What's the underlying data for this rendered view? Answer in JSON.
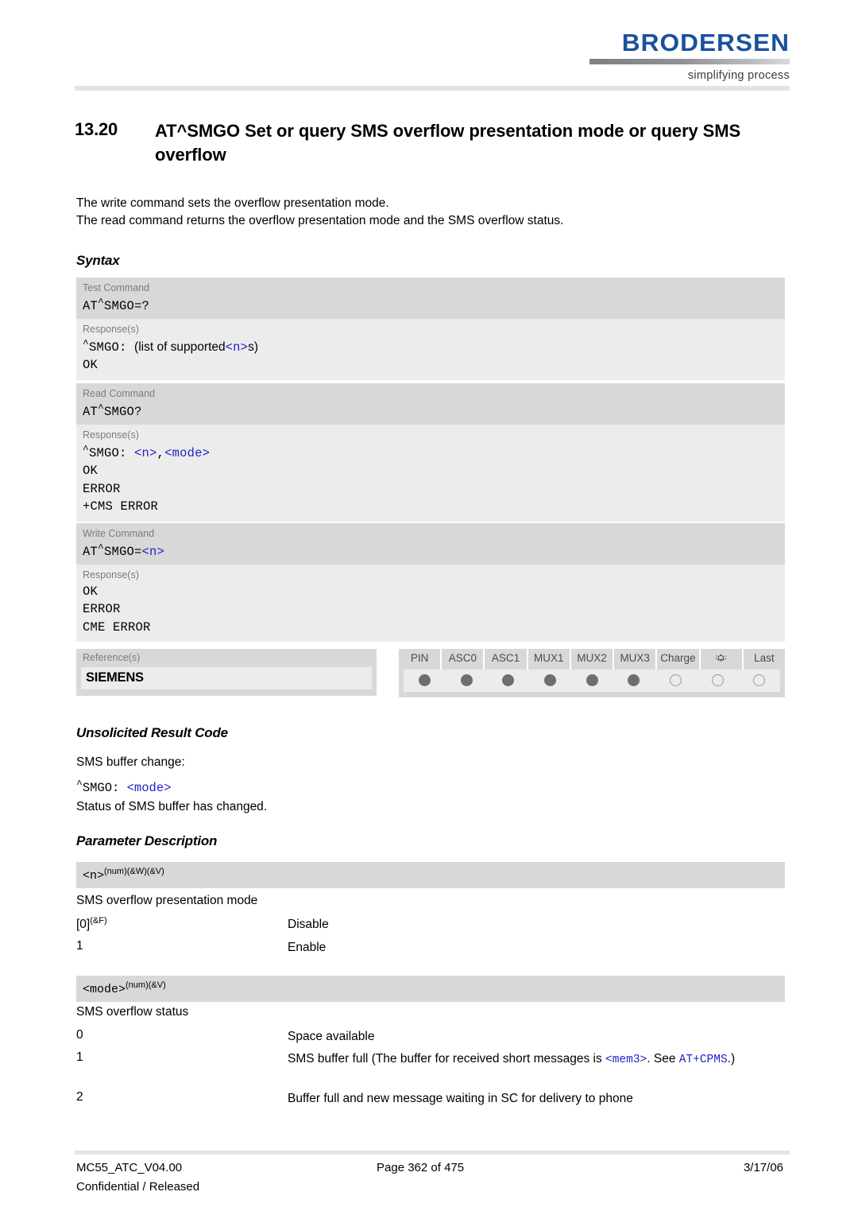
{
  "header": {
    "logo_word": "BRODERSEN",
    "logo_tagline": "simplifying process"
  },
  "title": {
    "number": "13.20",
    "text": "AT^SMGO  Set or query SMS overflow presentation mode or query SMS overflow"
  },
  "intro": {
    "line1": "The write command sets the overflow presentation mode.",
    "line2": "The read command returns the overflow presentation mode and the SMS overflow status."
  },
  "sections": {
    "syntax": "Syntax",
    "urc": "Unsolicited Result Code",
    "parameter": "Parameter Description"
  },
  "syntax": {
    "test": {
      "label": "Test Command",
      "command_pre": "AT",
      "command_caret": "^",
      "command_post": "SMGO=?",
      "response_label": "Response(s)",
      "resp_prefix": "^SMGO:",
      "resp_text": "(list of supported",
      "resp_param": "<n>",
      "resp_suffix": "s)",
      "resp_ok": "OK"
    },
    "read": {
      "label": "Read Command",
      "command_pre": "AT",
      "command_caret": "^",
      "command_post": "SMGO?",
      "response_label": "Response(s)",
      "resp_prefix": "^SMGO:",
      "resp_param1": "<n>",
      "resp_comma": ",",
      "resp_param2": "<mode>",
      "resp_lines": [
        "OK",
        "ERROR",
        "+CMS ERROR"
      ]
    },
    "write": {
      "label": "Write Command",
      "command_pre": "AT",
      "command_caret": "^",
      "command_post": "SMGO=",
      "command_param": "<n>",
      "response_label": "Response(s)",
      "resp_lines": [
        "OK",
        "ERROR",
        "CME ERROR"
      ]
    }
  },
  "reference": {
    "label": "Reference(s)",
    "value": "SIEMENS"
  },
  "status_table": {
    "columns": [
      {
        "label": "PIN",
        "state": "filled"
      },
      {
        "label": "ASC0",
        "state": "filled"
      },
      {
        "label": "ASC1",
        "state": "filled"
      },
      {
        "label": "MUX1",
        "state": "filled"
      },
      {
        "label": "MUX2",
        "state": "filled"
      },
      {
        "label": "MUX3",
        "state": "filled"
      },
      {
        "label": "Charge",
        "state": "empty"
      },
      {
        "label": "bell-icon",
        "state": "empty"
      },
      {
        "label": "Last",
        "state": "empty"
      }
    ]
  },
  "urc": {
    "intro": "SMS buffer change:",
    "code_prefix": "^SMGO:",
    "code_param": "<mode>",
    "description": "Status of SMS buffer has changed."
  },
  "parameters": [
    {
      "name": "<n>",
      "superscript": "(num)(&W)(&V)",
      "title": "SMS overflow presentation mode",
      "rows": [
        {
          "key": "[0]",
          "key_sup": "(&F)",
          "desc": "Disable"
        },
        {
          "key": "1",
          "key_sup": "",
          "desc": "Enable"
        }
      ]
    },
    {
      "name": "<mode>",
      "superscript": "(num)(&V)",
      "title": "SMS overflow status",
      "rows": [
        {
          "key": "0",
          "key_sup": "",
          "desc": "Space available"
        },
        {
          "key": "1",
          "key_sup": "",
          "desc_part1": "SMS buffer full (The buffer for received short messages is ",
          "desc_mono1": "<mem3>",
          "desc_part2": ". See ",
          "desc_mono2": "AT+CPMS",
          "desc_part3": ".)"
        },
        {
          "key": "2",
          "key_sup": "",
          "desc": "Buffer full and new message waiting in SC for delivery to phone"
        }
      ]
    }
  ],
  "footer": {
    "document": "MC55_ATC_V04.00",
    "page": "Page 362 of 475",
    "date": "3/17/06",
    "classification": "Confidential / Released"
  },
  "colors": {
    "brand_blue": "#1b50a0",
    "param_blue": "#2222c8",
    "band_dark": "#d8d8d8",
    "band_light": "#ececec"
  }
}
